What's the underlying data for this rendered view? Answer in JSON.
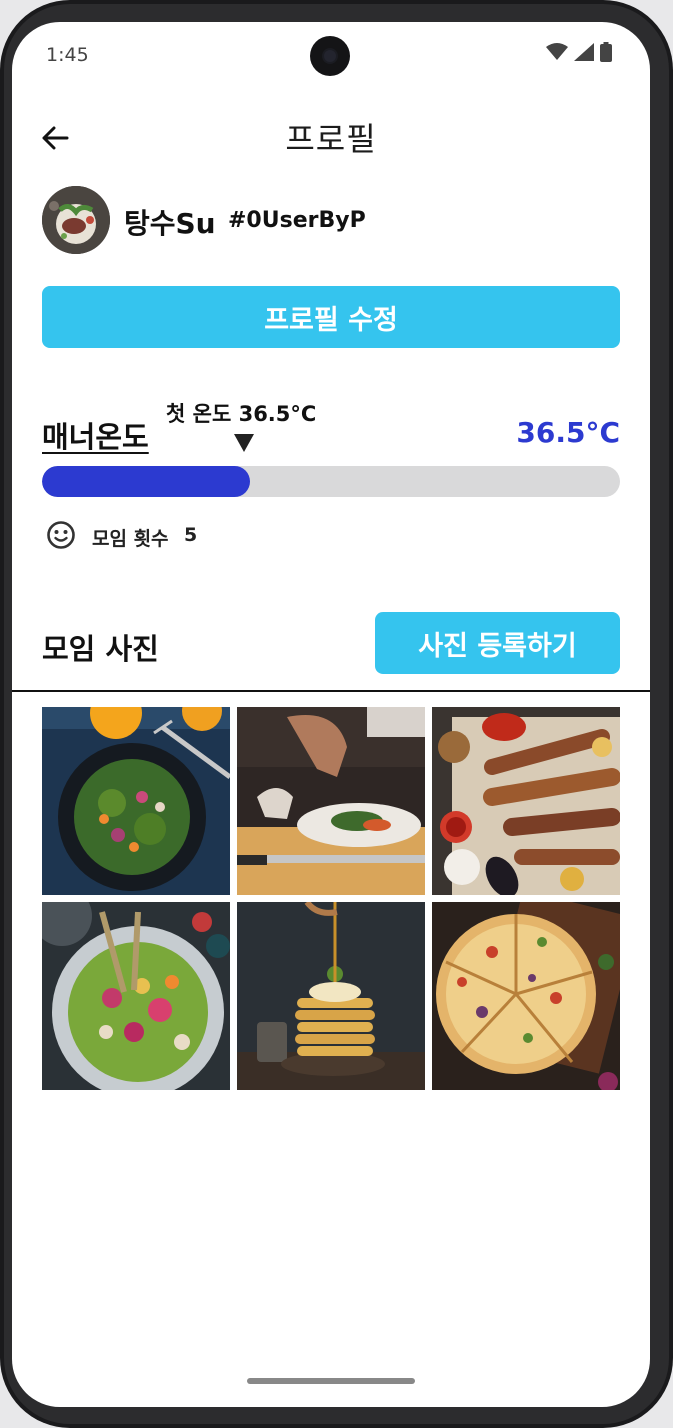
{
  "status_bar": {
    "time": "1:45"
  },
  "header": {
    "title": "프로필",
    "back_icon": "arrow-left-icon"
  },
  "user": {
    "name": "탕수Su",
    "tag": "#0UserByP"
  },
  "actions": {
    "edit_profile": "프로필 수정",
    "upload_photo": "사진 등록하기"
  },
  "manner": {
    "label": "매너온도",
    "first_temp_label": "첫 온도 36.5°C",
    "value_text": "36.5°C",
    "value": 36.5,
    "bar_fill_fraction": 0.36
  },
  "meet": {
    "icon": "smile-icon",
    "label": "모임 횟수",
    "count": "5"
  },
  "photos": {
    "title": "모임 사진",
    "items": [
      {
        "subject": "salad bowl"
      },
      {
        "subject": "chef plating dish"
      },
      {
        "subject": "grilled skewers"
      },
      {
        "subject": "green bowl with flowers"
      },
      {
        "subject": "pancake stack with syrup"
      },
      {
        "subject": "sliced pizza"
      }
    ]
  },
  "colors": {
    "accent_button": "#35c4ee",
    "temperature": "#2c3ad0",
    "track": "#d9d9da"
  }
}
